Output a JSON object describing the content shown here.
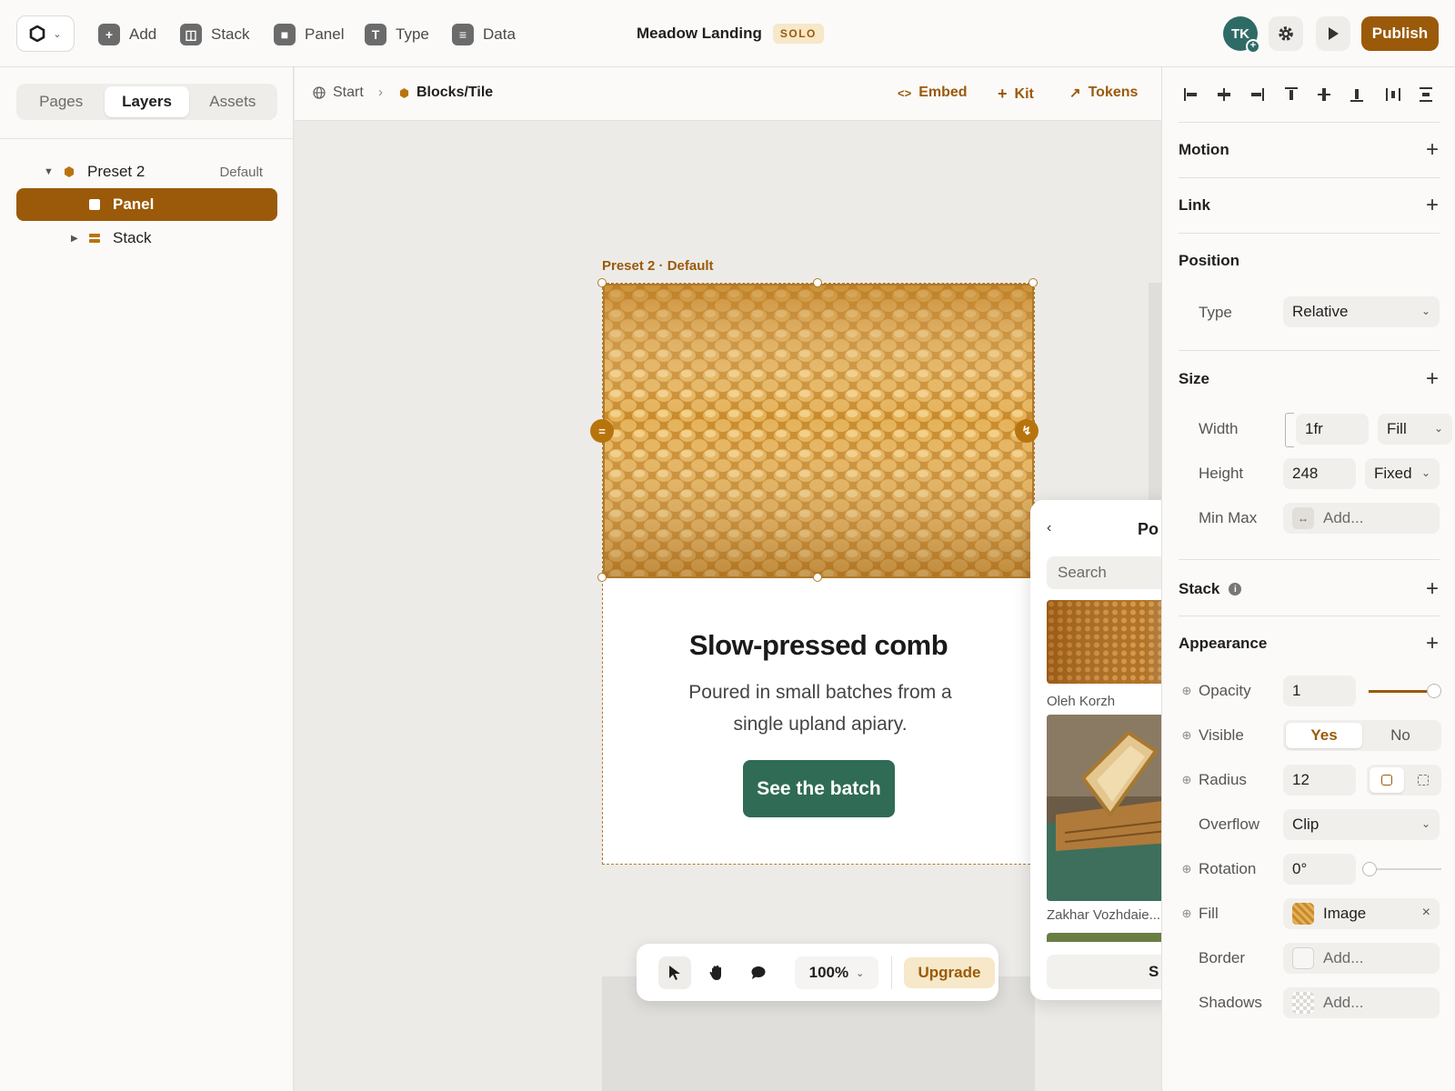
{
  "topbar": {
    "tools": [
      {
        "label": "Add",
        "icon": "plus-icon"
      },
      {
        "label": "Stack",
        "icon": "stack-layout-icon"
      },
      {
        "label": "Panel",
        "icon": "panel-icon"
      },
      {
        "label": "Type",
        "icon": "type-icon"
      },
      {
        "label": "Data",
        "icon": "database-icon"
      }
    ],
    "project_name": "Meadow Landing",
    "plan_badge": "SOLO",
    "avatar_initials": "TK",
    "publish_label": "Publish",
    "accent_color": "#9a5a0a"
  },
  "left_panel": {
    "tabs": [
      "Pages",
      "Layers",
      "Assets"
    ],
    "active_tab": "Layers",
    "layers": [
      {
        "name": "Preset 2",
        "meta": "Default",
        "expanded": true
      },
      {
        "name": "Panel",
        "selected": true
      },
      {
        "name": "Stack",
        "expanded": false
      }
    ]
  },
  "canvas": {
    "breadcrumb": {
      "root": "Start",
      "current": "Blocks/Tile"
    },
    "actions": [
      "Embed",
      "Kit",
      "Tokens"
    ],
    "frame_label": "Preset 2 · Default",
    "card": {
      "title": "Slow-pressed comb",
      "body": "Poured in small batches from a single upland apiary.",
      "cta": "See the batch"
    },
    "toolbar": {
      "zoom": "100%",
      "upgrade": "Upgrade"
    },
    "picker": {
      "title": "Po",
      "search_placeholder": "Search",
      "credits": [
        "Oleh Korzh",
        "Zakhar Vozhdaie..."
      ],
      "button": "S"
    }
  },
  "right_panel": {
    "sections": {
      "motion": "Motion",
      "link": "Link",
      "position": "Position",
      "size": "Size",
      "stack": "Stack",
      "appearance": "Appearance"
    },
    "position": {
      "type_label": "Type",
      "type_value": "Relative"
    },
    "size": {
      "width_label": "Width",
      "width_value": "1fr",
      "width_mode": "Fill",
      "height_label": "Height",
      "height_value": "248",
      "height_mode": "Fixed",
      "minmax_label": "Min Max",
      "minmax_placeholder": "Add..."
    },
    "appearance": {
      "opacity_label": "Opacity",
      "opacity_value": "1",
      "opacity_fraction": 1.0,
      "visible_label": "Visible",
      "visible_options": [
        "Yes",
        "No"
      ],
      "visible_selected": "Yes",
      "radius_label": "Radius",
      "radius_value": "12",
      "overflow_label": "Overflow",
      "overflow_value": "Clip",
      "rotation_label": "Rotation",
      "rotation_value": "0°",
      "rotation_fraction": 0.0,
      "fill_label": "Fill",
      "fill_value": "Image",
      "border_label": "Border",
      "border_placeholder": "Add...",
      "shadows_label": "Shadows",
      "shadows_placeholder": "Add..."
    }
  }
}
